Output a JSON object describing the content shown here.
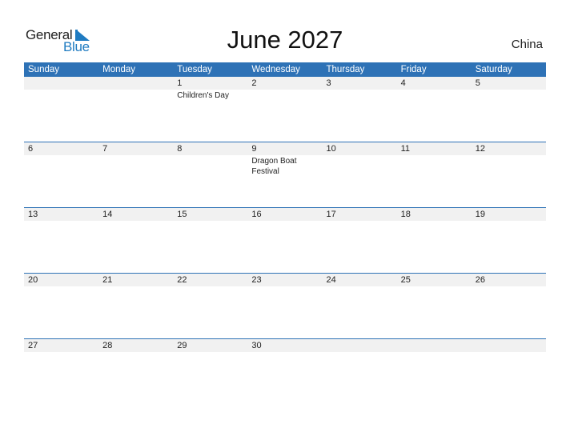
{
  "logo": {
    "part1": "General",
    "part2": "Blue"
  },
  "title": "June 2027",
  "country": "China",
  "weekdays": [
    "Sunday",
    "Monday",
    "Tuesday",
    "Wednesday",
    "Thursday",
    "Friday",
    "Saturday"
  ],
  "weeks": [
    [
      {
        "d": ""
      },
      {
        "d": ""
      },
      {
        "d": "1",
        "e": "Children's Day"
      },
      {
        "d": "2"
      },
      {
        "d": "3"
      },
      {
        "d": "4"
      },
      {
        "d": "5"
      }
    ],
    [
      {
        "d": "6"
      },
      {
        "d": "7"
      },
      {
        "d": "8"
      },
      {
        "d": "9",
        "e": "Dragon Boat Festival"
      },
      {
        "d": "10"
      },
      {
        "d": "11"
      },
      {
        "d": "12"
      }
    ],
    [
      {
        "d": "13"
      },
      {
        "d": "14"
      },
      {
        "d": "15"
      },
      {
        "d": "16"
      },
      {
        "d": "17"
      },
      {
        "d": "18"
      },
      {
        "d": "19"
      }
    ],
    [
      {
        "d": "20"
      },
      {
        "d": "21"
      },
      {
        "d": "22"
      },
      {
        "d": "23"
      },
      {
        "d": "24"
      },
      {
        "d": "25"
      },
      {
        "d": "26"
      }
    ],
    [
      {
        "d": "27"
      },
      {
        "d": "28"
      },
      {
        "d": "29"
      },
      {
        "d": "30"
      },
      {
        "d": ""
      },
      {
        "d": ""
      },
      {
        "d": ""
      }
    ]
  ],
  "colors": {
    "header": "#2e72b6",
    "brand": "#1f7bc1",
    "date_strip": "#f1f1f1"
  }
}
